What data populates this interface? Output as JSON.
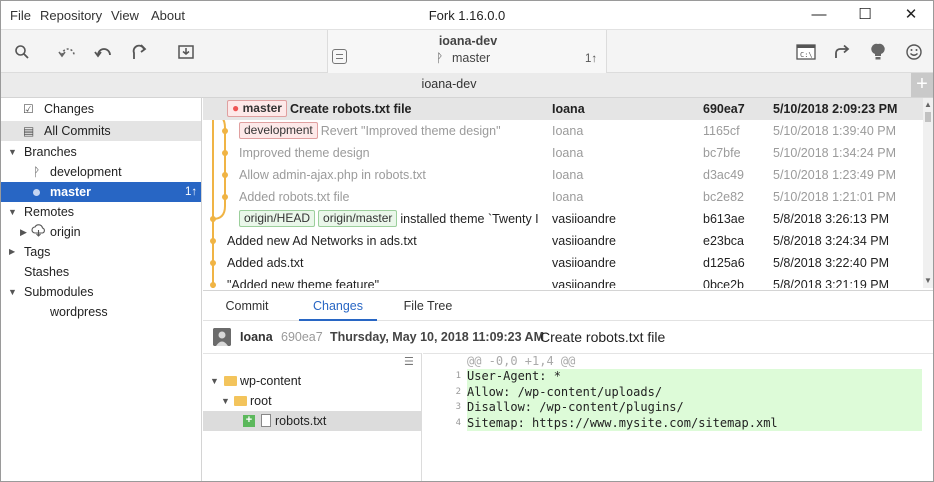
{
  "window": {
    "title": "Fork 1.16.0.0",
    "min": "—",
    "max": "☐",
    "close": "✕"
  },
  "menu": [
    "File",
    "Repository",
    "View",
    "About"
  ],
  "toolbar": {
    "repo_name": "ioana-dev",
    "branch": "master",
    "ahead": "1↑",
    "icons": [
      "search-icon",
      "fetch-icon",
      "pull-icon",
      "push-icon",
      "stash-icon",
      "terminal-icon",
      "share-icon",
      "bulb-icon",
      "smiley-icon"
    ]
  },
  "tab": {
    "label": "ioana-dev",
    "add": "+"
  },
  "sidebar": {
    "changes": "Changes",
    "all_commits": "All Commits",
    "branches": "Branches",
    "branch_items": [
      {
        "name": "development"
      },
      {
        "name": "master",
        "badge": "1↑"
      }
    ],
    "remotes": "Remotes",
    "remote_items": [
      "origin"
    ],
    "tags": "Tags",
    "stashes": "Stashes",
    "submodules": "Submodules",
    "submodule_items": [
      "wordpress"
    ]
  },
  "commits": [
    {
      "tags": [
        {
          "label": "master",
          "color": "red",
          "dot": true
        }
      ],
      "message": "Create robots.txt file",
      "author": "Ioana",
      "hash": "690ea7",
      "date": "5/10/2018 2:09:23 PM",
      "state": "selected"
    },
    {
      "tags": [
        {
          "label": "development",
          "color": "red"
        }
      ],
      "message": "Revert \"Improved theme design\"",
      "author": "Ioana",
      "hash": "1165cf",
      "date": "5/10/2018 1:39:40 PM",
      "state": "faded"
    },
    {
      "tags": [],
      "message": "Improved theme design",
      "author": "Ioana",
      "hash": "bc7bfe",
      "date": "5/10/2018 1:34:24 PM",
      "state": "faded"
    },
    {
      "tags": [],
      "message": "Allow admin-ajax.php in robots.txt",
      "author": "Ioana",
      "hash": "d3ac49",
      "date": "5/10/2018 1:23:49 PM",
      "state": "faded"
    },
    {
      "tags": [],
      "message": "Added robots.txt file",
      "author": "Ioana",
      "hash": "bc2e82",
      "date": "5/10/2018 1:21:01 PM",
      "state": "faded"
    },
    {
      "tags": [
        {
          "label": "origin/HEAD",
          "color": "green"
        },
        {
          "label": "origin/master",
          "color": "green"
        }
      ],
      "message": "installed theme `Twenty I",
      "author": "vasiioandre",
      "hash": "b613ae",
      "date": "5/8/2018 3:26:13 PM",
      "state": "normal"
    },
    {
      "tags": [],
      "message": "Added new Ad Networks in ads.txt",
      "author": "vasiioandre",
      "hash": "e23bca",
      "date": "5/8/2018 3:24:34 PM",
      "state": "normal"
    },
    {
      "tags": [],
      "message": "Added ads.txt",
      "author": "vasiioandre",
      "hash": "d125a6",
      "date": "5/8/2018 3:22:40 PM",
      "state": "normal"
    },
    {
      "tags": [],
      "message": "\"Added new theme feature\"",
      "author": "vasiioandre",
      "hash": "0bce2b",
      "date": "5/8/2018 3:21:19 PM",
      "state": "normal"
    }
  ],
  "details": {
    "tabs": [
      "Commit",
      "Changes",
      "File Tree"
    ],
    "active_tab": "Changes",
    "author": "Ioana",
    "hash": "690ea7",
    "date": "Thursday, May 10, 2018 11:09:23 AM",
    "message": "Create robots.txt file",
    "tree": [
      {
        "name": "wp-content",
        "type": "folder",
        "depth": 0
      },
      {
        "name": "root",
        "type": "folder",
        "depth": 1
      },
      {
        "name": "robots.txt",
        "type": "file",
        "depth": 2,
        "status": "+"
      }
    ],
    "diff_header": "@@ -0,0 +1,4 @@",
    "diff_lines": [
      {
        "n": "1",
        "text": "User-Agent: *"
      },
      {
        "n": "2",
        "text": "Allow: /wp-content/uploads/"
      },
      {
        "n": "3",
        "text": "Disallow: /wp-content/plugins/"
      },
      {
        "n": "4",
        "text": "Sitemap: https://www.mysite.com/sitemap.xml"
      }
    ]
  },
  "colors": {
    "accent": "#2866c4",
    "graph": "#f0b445",
    "added_bg": "#ddfbd8",
    "tag_red": "#e0a0a0",
    "tag_green": "#9ccf9c"
  }
}
